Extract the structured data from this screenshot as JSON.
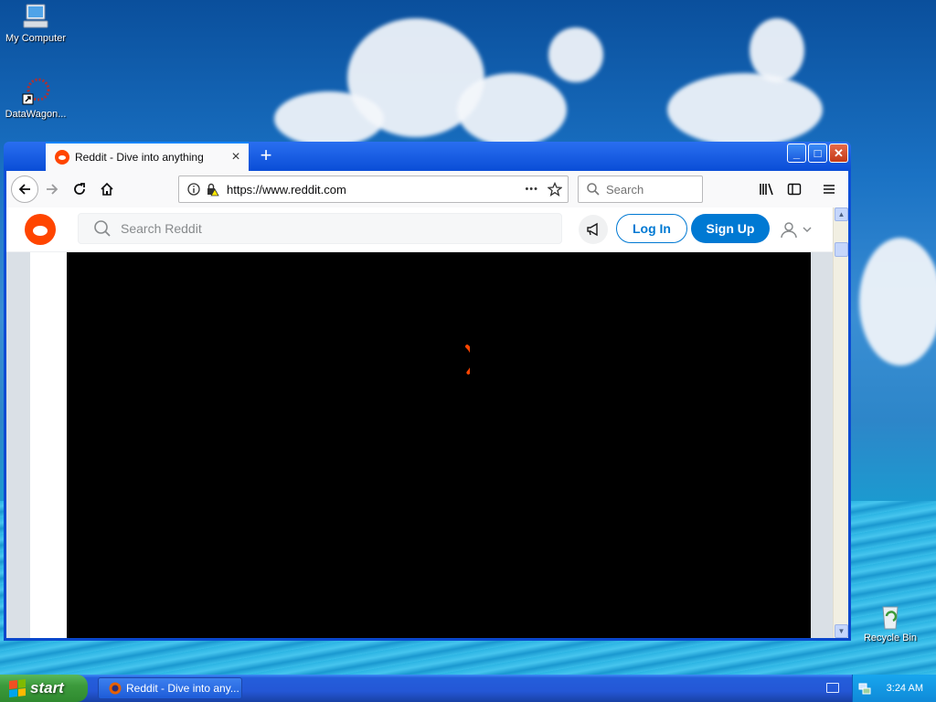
{
  "desktop": {
    "icons": [
      {
        "label": "My Computer"
      },
      {
        "label": "DataWagon..."
      },
      {
        "label": "Recycle Bin"
      }
    ]
  },
  "browser": {
    "tab": {
      "title": "Reddit - Dive into anything",
      "close": "×"
    },
    "new_tab": "+",
    "window_buttons": {
      "minimize": "_",
      "maximize": "□",
      "close": "✕"
    },
    "url": "https://www.reddit.com",
    "search_placeholder": "Search",
    "page_actions": "•••"
  },
  "reddit": {
    "search_placeholder": "Search Reddit",
    "login_label": "Log In",
    "signup_label": "Sign Up"
  },
  "colors": {
    "reddit_orange": "#ff4500",
    "reddit_blue": "#0079d3",
    "spinner": "#ff4500"
  },
  "taskbar": {
    "start_label": "start",
    "window_item": "Reddit - Dive into any...",
    "clock": "3:24 AM"
  }
}
